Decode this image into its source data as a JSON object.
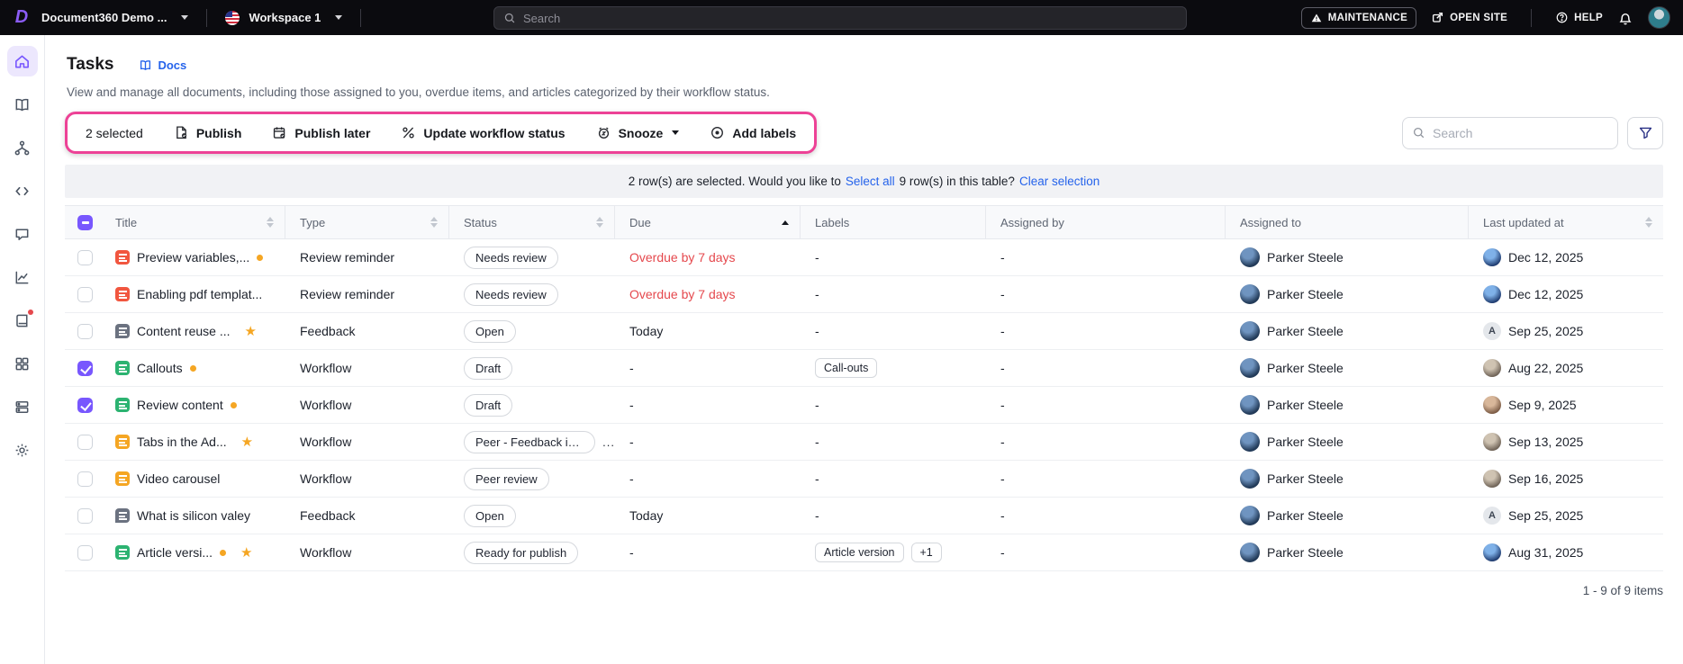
{
  "topbar": {
    "project_name": "Document360 Demo ...",
    "workspace": "Workspace 1",
    "search_placeholder": "Search",
    "maintenance_label": "MAINTENANCE",
    "open_site_label": "OPEN SITE",
    "help_label": "HELP"
  },
  "sidebar": {
    "items": [
      {
        "name": "home",
        "active": true
      },
      {
        "name": "documentation",
        "active": false
      },
      {
        "name": "categories",
        "active": false
      },
      {
        "name": "api-docs",
        "active": false
      },
      {
        "name": "feedback",
        "active": false
      },
      {
        "name": "analytics",
        "active": false
      },
      {
        "name": "knowledge-base",
        "active": false,
        "badge": true
      },
      {
        "name": "widgets",
        "active": false
      },
      {
        "name": "drive",
        "active": false
      },
      {
        "name": "settings",
        "active": false
      }
    ]
  },
  "page": {
    "title": "Tasks",
    "docs_link": "Docs",
    "description": "View and manage all documents, including those assigned to you, overdue items, and articles categorized by their workflow status."
  },
  "toolbar": {
    "selected_count": "2 selected",
    "publish_label": "Publish",
    "publish_later_label": "Publish later",
    "update_workflow_label": "Update workflow status",
    "snooze_label": "Snooze",
    "add_labels_label": "Add labels",
    "search_placeholder": "Search"
  },
  "selection_banner": {
    "prefix": "2 row(s) are selected. Would you like to",
    "select_all_link": "Select all",
    "middle": "9 row(s) in this table?",
    "clear_link": "Clear selection"
  },
  "table": {
    "columns": [
      {
        "key": "checkbox",
        "label": "",
        "sort": "none"
      },
      {
        "key": "title",
        "label": "Title",
        "sort": "both"
      },
      {
        "key": "type",
        "label": "Type",
        "sort": "both"
      },
      {
        "key": "status",
        "label": "Status",
        "sort": "both"
      },
      {
        "key": "due",
        "label": "Due",
        "sort": "asc-active"
      },
      {
        "key": "labels",
        "label": "Labels",
        "sort": "none"
      },
      {
        "key": "assigned-by",
        "label": "Assigned by",
        "sort": "none"
      },
      {
        "key": "assigned-to",
        "label": "Assigned to",
        "sort": "none"
      },
      {
        "key": "last-updated-at",
        "label": "Last updated at",
        "sort": "both"
      }
    ],
    "rows": [
      {
        "checked": false,
        "icon": "doc-red",
        "title": "Preview variables,...",
        "dot": true,
        "star": false,
        "type": "Review reminder",
        "status": "Needs review",
        "status_more": "",
        "due": "Overdue by 7 days",
        "overdue": true,
        "labels": [],
        "assigned_by": "-",
        "assigned_to": "Parker Steele",
        "updated": "Dec 12, 2025",
        "updated_avatar": "photo-blue",
        "updated_avatar_letter": ""
      },
      {
        "checked": false,
        "icon": "doc-red",
        "title": "Enabling pdf templat...",
        "dot": false,
        "star": false,
        "type": "Review reminder",
        "status": "Needs review",
        "status_more": "",
        "due": "Overdue by 7 days",
        "overdue": true,
        "labels": [],
        "assigned_by": "-",
        "assigned_to": "Parker Steele",
        "updated": "Dec 12, 2025",
        "updated_avatar": "photo-blue",
        "updated_avatar_letter": ""
      },
      {
        "checked": false,
        "icon": "comment",
        "title": "Content reuse ...",
        "dot": false,
        "star": true,
        "type": "Feedback",
        "status": "Open",
        "status_more": "",
        "due": "Today",
        "overdue": false,
        "labels": [],
        "assigned_by": "-",
        "assigned_to": "Parker Steele",
        "updated": "Sep 25, 2025",
        "updated_avatar": "letter",
        "updated_avatar_letter": "A"
      },
      {
        "checked": true,
        "icon": "doc-green",
        "title": "Callouts",
        "dot": true,
        "star": false,
        "type": "Workflow",
        "status": "Draft",
        "status_more": "",
        "due": "-",
        "overdue": false,
        "labels": [
          "Call-outs"
        ],
        "assigned_by": "-",
        "assigned_to": "Parker Steele",
        "updated": "Aug 22, 2025",
        "updated_avatar": "photo-gray",
        "updated_avatar_letter": ""
      },
      {
        "checked": true,
        "icon": "doc-green",
        "title": "Review content",
        "dot": true,
        "star": false,
        "type": "Workflow",
        "status": "Draft",
        "status_more": "",
        "due": "-",
        "overdue": false,
        "labels": [],
        "assigned_by": "-",
        "assigned_to": "Parker Steele",
        "updated": "Sep 9, 2025",
        "updated_avatar": "photo-warm",
        "updated_avatar_letter": ""
      },
      {
        "checked": false,
        "icon": "doc-orange",
        "title": "Tabs in the Ad...",
        "dot": false,
        "star": true,
        "type": "Workflow",
        "status": "Peer - Feedback inc...",
        "status_more": "...",
        "due": "-",
        "overdue": false,
        "labels": [],
        "assigned_by": "-",
        "assigned_to": "Parker Steele",
        "updated": "Sep 13, 2025",
        "updated_avatar": "photo-gray",
        "updated_avatar_letter": ""
      },
      {
        "checked": false,
        "icon": "doc-orange",
        "title": "Video carousel",
        "dot": false,
        "star": false,
        "type": "Workflow",
        "status": "Peer review",
        "status_more": "",
        "due": "-",
        "overdue": false,
        "labels": [],
        "assigned_by": "-",
        "assigned_to": "Parker Steele",
        "updated": "Sep 16, 2025",
        "updated_avatar": "photo-gray",
        "updated_avatar_letter": ""
      },
      {
        "checked": false,
        "icon": "comment",
        "title": "What is silicon valey",
        "dot": false,
        "star": false,
        "type": "Feedback",
        "status": "Open",
        "status_more": "",
        "due": "Today",
        "overdue": false,
        "labels": [],
        "assigned_by": "-",
        "assigned_to": "Parker Steele",
        "updated": "Sep 25, 2025",
        "updated_avatar": "letter",
        "updated_avatar_letter": "A"
      },
      {
        "checked": false,
        "icon": "doc-green",
        "title": "Article versi...",
        "dot": true,
        "star": true,
        "type": "Workflow",
        "status": "Ready for publish",
        "status_more": "",
        "due": "-",
        "overdue": false,
        "labels": [
          "Article version",
          "+1"
        ],
        "assigned_by": "-",
        "assigned_to": "Parker Steele",
        "updated": "Aug 31, 2025",
        "updated_avatar": "photo-blue",
        "updated_avatar_letter": ""
      }
    ]
  },
  "pagination": {
    "summary": "1 - 9 of 9 items"
  },
  "colors": {
    "accent_purple": "#7857fe",
    "highlight_pink": "#ed4296",
    "link_blue": "#2563eb",
    "overdue_red": "#e5484d",
    "topbar_black": "#0b0b0f",
    "icon_red": "#f1563f",
    "icon_green": "#2cb371",
    "icon_orange": "#f5a623"
  }
}
